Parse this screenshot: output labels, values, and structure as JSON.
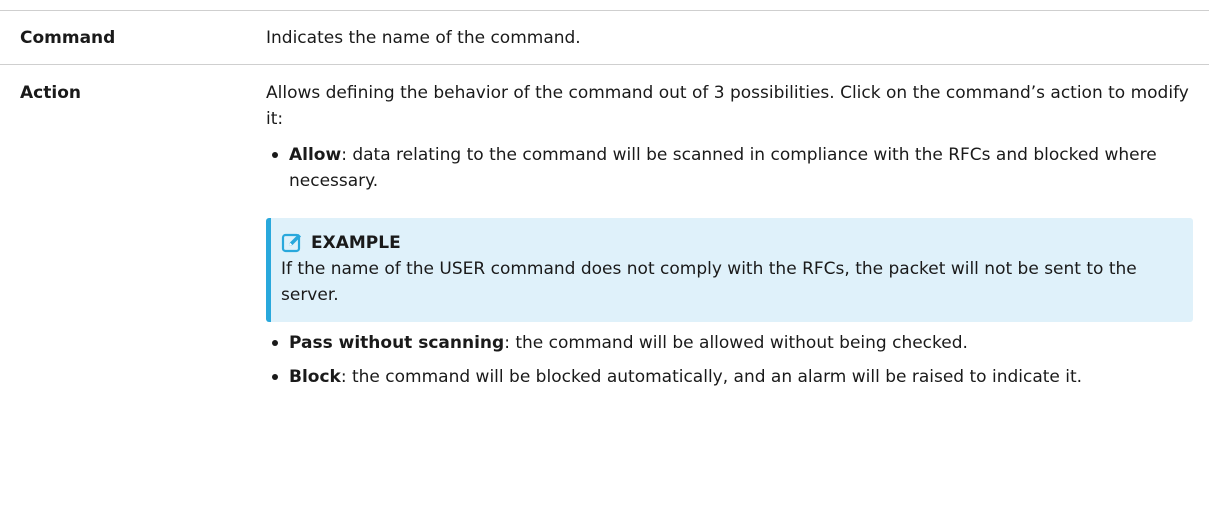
{
  "rows": {
    "command": {
      "term": "Command",
      "description": "Indicates the name of the command."
    },
    "action": {
      "term": "Action",
      "intro": "Allows defining the behavior of the command out of 3 possibilities. Click on the command’s action to modify it:",
      "options": [
        {
          "name": "Allow",
          "text": ": data relating to the command will be scanned in compliance with the RFCs and blocked where necessary."
        },
        {
          "name": "Pass without scanning",
          "text": ": the command will be allowed without being checked."
        },
        {
          "name": "Block",
          "text": ": the command will be blocked automatically, and an alarm will be raised to indicate it."
        }
      ],
      "example": {
        "icon": "edit-note-icon",
        "title": "EXAMPLE",
        "text": "If the name of the USER command does not comply with the RFCs, the packet will not be sent to the server."
      }
    }
  },
  "colors": {
    "divider": "#cfcfcf",
    "example_background": "#dff1fa",
    "example_accent": "#29a8dc"
  }
}
